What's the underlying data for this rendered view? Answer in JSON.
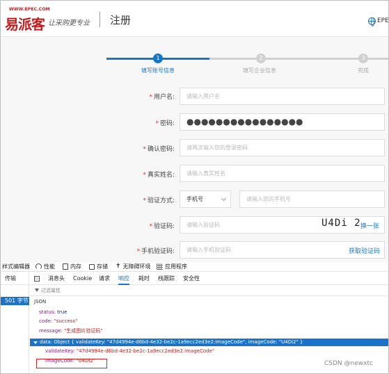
{
  "header": {
    "logo_url": "WWW.EPEC.COM",
    "logo_mark": "易派客",
    "logo_slogan": "让采购更专业",
    "page_title": "注册",
    "lang": "EPE"
  },
  "colors": {
    "accent": "#1677c9",
    "required": "#e0302b",
    "step_inactive": "#d0d0d0"
  },
  "steps": [
    {
      "number": "1",
      "label": "填写账号信息",
      "active": true
    },
    {
      "number": "2",
      "label": "填写企业信息",
      "active": false
    },
    {
      "number": "3",
      "label": "完成",
      "active": false
    }
  ],
  "form": {
    "username": {
      "label": "用户名:",
      "placeholder": "请输入用户名"
    },
    "password": {
      "label": "密码:",
      "value": "●●●●●●●●●●●●●●●●"
    },
    "confirm_password": {
      "label": "确认密码:",
      "placeholder": "请再次输入您的登录密码"
    },
    "real_name": {
      "label": "真实姓名:",
      "placeholder": "请输入真实姓名"
    },
    "verify_method": {
      "label": "验证方式:",
      "selected": "手机号",
      "phone_placeholder": "请输入您的手机号"
    },
    "captcha": {
      "label": "验证码:",
      "placeholder": "请输入验证码",
      "image_text": "U4Di 2",
      "refresh_label": "换一张"
    },
    "sms_code": {
      "label": "手机验证码:",
      "placeholder": "请输入手机验证码",
      "get_code_label": "获取验证码"
    }
  },
  "devtools": {
    "toolbar": [
      "样式编辑器",
      "性能",
      "内存",
      "存储",
      "无障碍环境",
      "应用程序"
    ],
    "left_header": "传输",
    "left_selected": "501 字节",
    "detail_tabs": [
      "消息头",
      "Cookie",
      "请求",
      "响应",
      "耗时",
      "栈跟踪",
      "安全性"
    ],
    "active_tab": "响应",
    "filter_placeholder": "过滤属性",
    "json_title": "JSON",
    "json": {
      "status_key": "status:",
      "status_val": "true",
      "code_key": "code:",
      "code_val": "\"success\"",
      "message_key": "message:",
      "message_val": "\"生成图片验证码\"",
      "data_line": "data: Object { validateKey: \"47d4994e-d6bd-4e32-be2c-1a9ecc2ed3e2:imageCode\", imageCode: \"U4Di2\" }",
      "validate_key": "validateKey:",
      "validate_val": "\"47d4994e-d6bd-4e32-be2c-1a9ecc2ed3e2:imageCode\"",
      "image_code_key": "imageCode:",
      "image_code_val": "\"U4Di2\""
    }
  },
  "watermark": "CSDN @newxtc"
}
